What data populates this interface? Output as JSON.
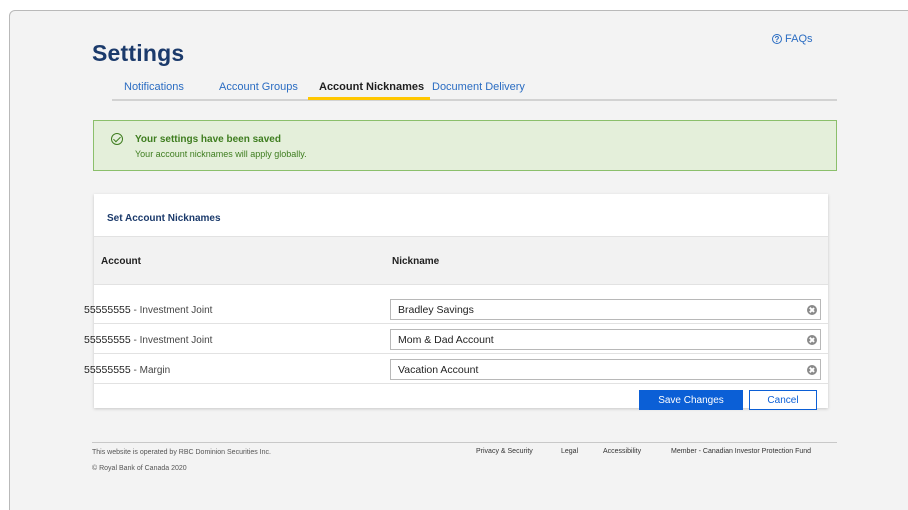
{
  "page": {
    "title": "Settings",
    "faqs_label": "FAQs"
  },
  "tabs": [
    {
      "label": "Notifications"
    },
    {
      "label": "Account Groups"
    },
    {
      "label": "Account Nicknames",
      "active": true
    },
    {
      "label": "Document Delivery"
    }
  ],
  "alert": {
    "title": "Your settings have been saved",
    "text": "Your account nicknames will apply globally."
  },
  "card": {
    "title": "Set Account Nicknames",
    "columns": {
      "account": "Account",
      "nickname": "Nickname"
    },
    "rows": [
      {
        "account_number": "55555555",
        "account_type": "Investment Joint",
        "nickname": "Bradley Savings"
      },
      {
        "account_number": "55555555",
        "account_type": "Investment Joint",
        "nickname": "Mom & Dad Account"
      },
      {
        "account_number": "55555555",
        "account_type": "Margin",
        "nickname": "Vacation Account"
      }
    ],
    "save_label": "Save Changes",
    "cancel_label": "Cancel"
  },
  "footer": {
    "operated_by": "This website is operated by RBC Dominion Securities Inc.",
    "copyright": "© Royal Bank of Canada 2020",
    "links": [
      "Privacy & Security",
      "Legal",
      "Accessibility",
      "Member - Canadian Investor Protection Fund"
    ]
  },
  "colors": {
    "accent_blue": "#0b5fd6",
    "title_navy": "#1b3a6b",
    "tab_underline_yellow": "#ffc700",
    "success_green": "#3e7d1f",
    "success_bg": "#e4efda"
  }
}
